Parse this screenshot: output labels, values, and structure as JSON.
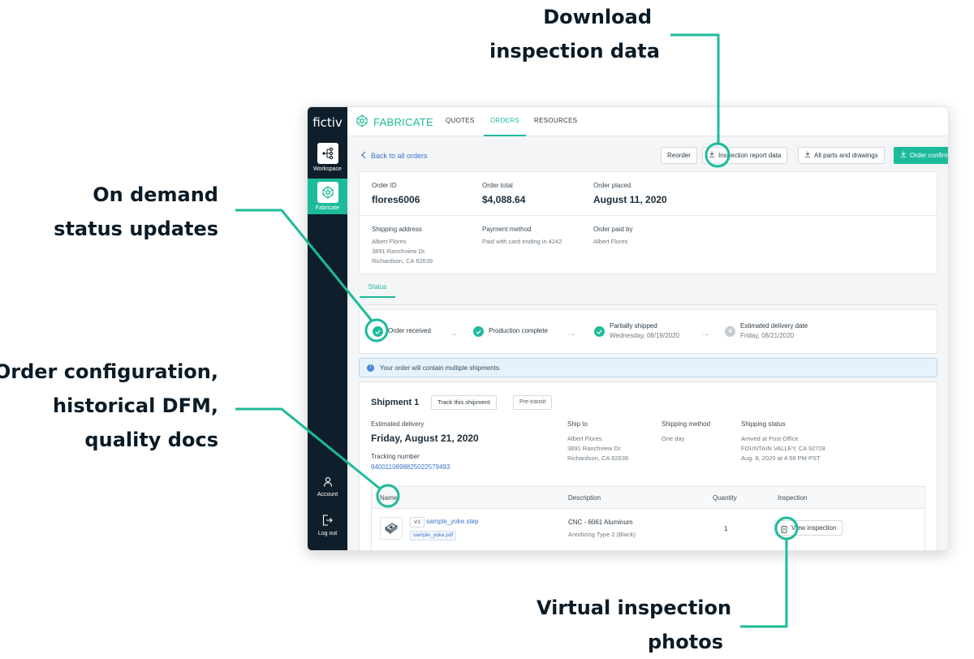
{
  "callouts": {
    "download": [
      "Download",
      "inspection data"
    ],
    "status": [
      "On demand",
      "status updates"
    ],
    "config": [
      "Order configuration,",
      "historical DFM,",
      "quality docs"
    ],
    "virtual": [
      "Virtual inspection",
      "photos"
    ]
  },
  "colors": {
    "accent": "#1dbb9b",
    "sidebar": "#0e1f2b",
    "link": "#3b73c9"
  },
  "sidebar": {
    "logo": "fictiv",
    "items": [
      {
        "label": "Workspace",
        "icon": "workflow-icon"
      },
      {
        "label": "Fabricate",
        "icon": "cube-network-icon"
      },
      {
        "label": "Account",
        "icon": "person-icon"
      },
      {
        "label": "Log out",
        "icon": "logout-icon"
      }
    ]
  },
  "topbar": {
    "brand": "FABRICATE",
    "nav": {
      "quotes": "QUOTES",
      "orders": "ORDERS",
      "resources": "RESOURCES"
    }
  },
  "toolbar": {
    "back": "Back to all orders",
    "reorder": "Reorder",
    "inspection": "Inspection report data",
    "parts": "All parts and drawings",
    "confirmation": "Order confirmation"
  },
  "order": {
    "id_label": "Order ID",
    "id": "flores6006",
    "total_label": "Order total",
    "total": "$4,088.64",
    "placed_label": "Order placed",
    "placed": "August 11, 2020",
    "ship_label": "Shipping address",
    "ship_name": "Albert Flores",
    "ship_street": "3891 Ranchview Dr.",
    "ship_city": "Richardson, CA 62639",
    "pay_label": "Payment method",
    "pay": "Paid with card ending in 4242",
    "paidby_label": "Order paid by",
    "paidby": "Albert Flores"
  },
  "status_tab": "Status",
  "steps": [
    {
      "label": "Order received",
      "sub": ""
    },
    {
      "label": "Production complete",
      "sub": ""
    },
    {
      "label": "Partially shipped",
      "sub": "Wednesday, 08/19/2020"
    },
    {
      "label": "Estimated delivery date",
      "sub": "Friday, 08/21/2020",
      "number": "4"
    }
  ],
  "notice": "Your order will contain multiple shipments.",
  "shipment": {
    "title": "Shipment 1",
    "track": "Track this shipment",
    "badge": "Pre-transit",
    "est_label": "Estimated delivery",
    "est": "Friday, August 21, 2020",
    "tracking_label": "Tracking number",
    "tracking": "9400110898825022579493",
    "shipto_label": "Ship to",
    "shipto_name": "Albert Flores",
    "shipto_street": "3891 Ranchview Dr.",
    "shipto_city": "Richardson, CA 62639",
    "method_label": "Shipping method",
    "method": "One day",
    "status_label": "Shipping status",
    "status_1": "Arrived at Post Office",
    "status_2": "FOUNTAIN VALLEY, CA 92728",
    "status_3": "Aug. 8, 2020 at 4:58 PM PST"
  },
  "table": {
    "headers": {
      "name": "Name",
      "description": "Description",
      "quantity": "Quantity",
      "inspection": "Inspection"
    },
    "row": {
      "version": "V1",
      "file": "sample_yoke.step",
      "pdf": "sample_yoke.pdf",
      "desc_1": "CNC - 6061 Aluminum",
      "desc_2": "Anodizing Type 2 (Black)",
      "qty": "1",
      "inspection": "View inspection"
    }
  }
}
